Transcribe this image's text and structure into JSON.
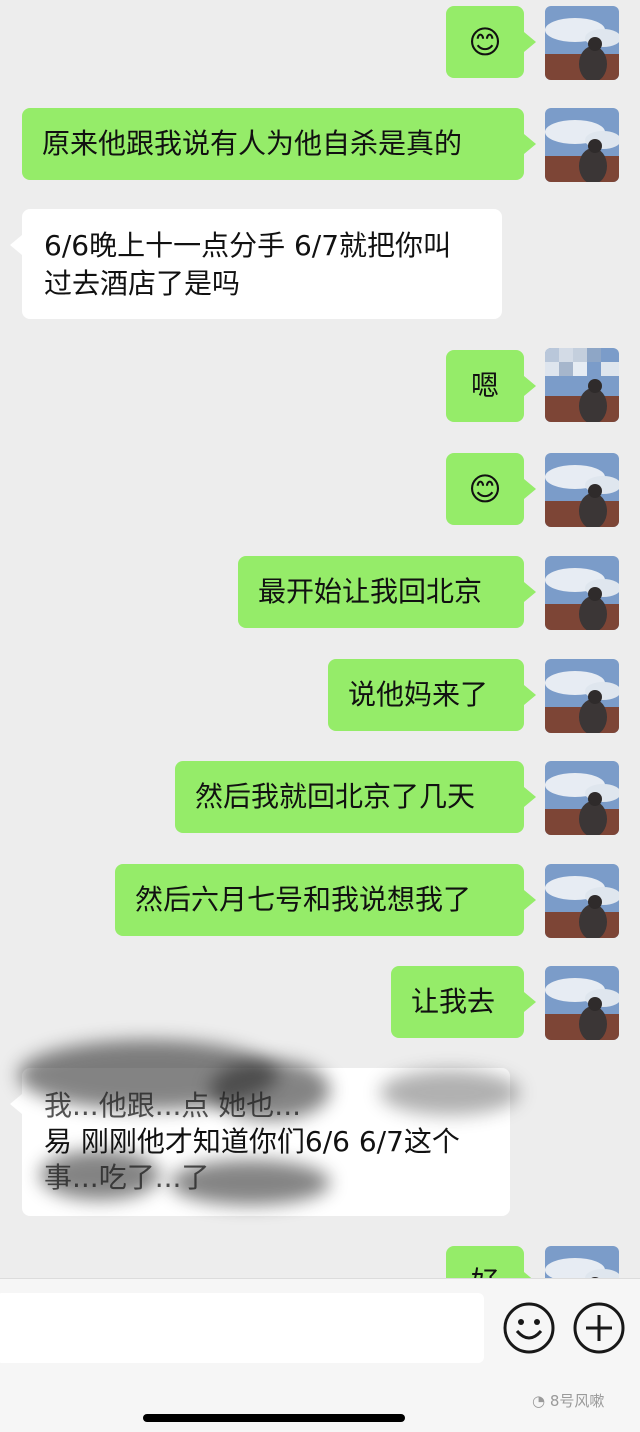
{
  "messages": [
    {
      "id": "m1",
      "text": "😊"
    },
    {
      "id": "m2",
      "text": "原来他跟我说有人为他自杀是真的"
    },
    {
      "id": "m3",
      "lines": [
        "6/6晚上十一点分手 6/7就把你叫",
        "过去酒店了是吗"
      ]
    },
    {
      "id": "m4",
      "text": "嗯"
    },
    {
      "id": "m5",
      "text": "😊"
    },
    {
      "id": "m6",
      "text": "最开始让我回北京"
    },
    {
      "id": "m7",
      "text": "说他妈来了"
    },
    {
      "id": "m8",
      "text": "然后我就回北京了几天"
    },
    {
      "id": "m9",
      "text": "然后六月七号和我说想我了"
    },
    {
      "id": "m10",
      "text": "让我去"
    },
    {
      "id": "m11",
      "lines": [
        "我...他跟...点 她也...",
        "易 刚刚他才知道你们6/6 6/7这个",
        "事...吃了...了"
      ]
    },
    {
      "id": "m12",
      "text": "好"
    }
  ],
  "input_bar": {
    "emoji_icon": "emoji-icon",
    "add_icon": "plus-circle-icon"
  },
  "watermark": "8号风嗽",
  "colors": {
    "background": "#ededed",
    "outgoing_bubble": "#95ec69",
    "incoming_bubble": "#ffffff"
  }
}
